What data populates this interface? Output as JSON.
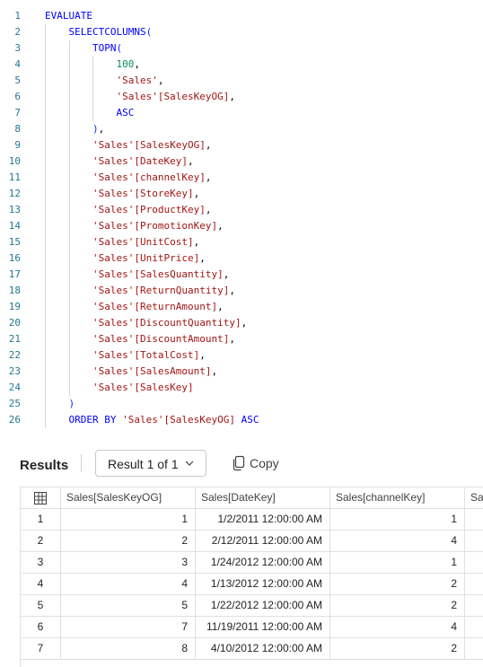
{
  "editor": {
    "lines": [
      {
        "n": "1",
        "indent": 0,
        "tokens": [
          {
            "t": "EVALUATE",
            "c": "keyword"
          }
        ]
      },
      {
        "n": "2",
        "indent": 1,
        "tokens": [
          {
            "t": "SELECTCOLUMNS",
            "c": "func"
          },
          {
            "t": "(",
            "c": "punct"
          }
        ]
      },
      {
        "n": "3",
        "indent": 2,
        "tokens": [
          {
            "t": "TOPN",
            "c": "func"
          },
          {
            "t": "(",
            "c": "punct"
          }
        ]
      },
      {
        "n": "4",
        "indent": 3,
        "tokens": [
          {
            "t": "100",
            "c": "number"
          },
          {
            "t": ",",
            "c": "plain"
          }
        ]
      },
      {
        "n": "5",
        "indent": 3,
        "tokens": [
          {
            "t": "'Sales'",
            "c": "string"
          },
          {
            "t": ",",
            "c": "plain"
          }
        ]
      },
      {
        "n": "6",
        "indent": 3,
        "tokens": [
          {
            "t": "'Sales'[SalesKeyOG]",
            "c": "column"
          },
          {
            "t": ",",
            "c": "plain"
          }
        ]
      },
      {
        "n": "7",
        "indent": 3,
        "tokens": [
          {
            "t": "ASC",
            "c": "keyword"
          }
        ]
      },
      {
        "n": "8",
        "indent": 2,
        "tokens": [
          {
            "t": ")",
            "c": "punct"
          },
          {
            "t": ",",
            "c": "plain"
          }
        ]
      },
      {
        "n": "9",
        "indent": 2,
        "tokens": [
          {
            "t": "'Sales'[SalesKeyOG]",
            "c": "column"
          },
          {
            "t": ",",
            "c": "plain"
          }
        ]
      },
      {
        "n": "10",
        "indent": 2,
        "tokens": [
          {
            "t": "'Sales'[DateKey]",
            "c": "column"
          },
          {
            "t": ",",
            "c": "plain"
          }
        ]
      },
      {
        "n": "11",
        "indent": 2,
        "tokens": [
          {
            "t": "'Sales'[channelKey]",
            "c": "column"
          },
          {
            "t": ",",
            "c": "plain"
          }
        ]
      },
      {
        "n": "12",
        "indent": 2,
        "tokens": [
          {
            "t": "'Sales'[StoreKey]",
            "c": "column"
          },
          {
            "t": ",",
            "c": "plain"
          }
        ]
      },
      {
        "n": "13",
        "indent": 2,
        "tokens": [
          {
            "t": "'Sales'[ProductKey]",
            "c": "column"
          },
          {
            "t": ",",
            "c": "plain"
          }
        ]
      },
      {
        "n": "14",
        "indent": 2,
        "tokens": [
          {
            "t": "'Sales'[PromotionKey]",
            "c": "column"
          },
          {
            "t": ",",
            "c": "plain"
          }
        ]
      },
      {
        "n": "15",
        "indent": 2,
        "tokens": [
          {
            "t": "'Sales'[UnitCost]",
            "c": "column"
          },
          {
            "t": ",",
            "c": "plain"
          }
        ]
      },
      {
        "n": "16",
        "indent": 2,
        "tokens": [
          {
            "t": "'Sales'[UnitPrice]",
            "c": "column"
          },
          {
            "t": ",",
            "c": "plain"
          }
        ]
      },
      {
        "n": "17",
        "indent": 2,
        "tokens": [
          {
            "t": "'Sales'[SalesQuantity]",
            "c": "column"
          },
          {
            "t": ",",
            "c": "plain"
          }
        ]
      },
      {
        "n": "18",
        "indent": 2,
        "tokens": [
          {
            "t": "'Sales'[ReturnQuantity]",
            "c": "column"
          },
          {
            "t": ",",
            "c": "plain"
          }
        ]
      },
      {
        "n": "19",
        "indent": 2,
        "tokens": [
          {
            "t": "'Sales'[ReturnAmount]",
            "c": "column"
          },
          {
            "t": ",",
            "c": "plain"
          }
        ]
      },
      {
        "n": "20",
        "indent": 2,
        "tokens": [
          {
            "t": "'Sales'[DiscountQuantity]",
            "c": "column"
          },
          {
            "t": ",",
            "c": "plain"
          }
        ]
      },
      {
        "n": "21",
        "indent": 2,
        "tokens": [
          {
            "t": "'Sales'[DiscountAmount]",
            "c": "column"
          },
          {
            "t": ",",
            "c": "plain"
          }
        ]
      },
      {
        "n": "22",
        "indent": 2,
        "tokens": [
          {
            "t": "'Sales'[TotalCost]",
            "c": "column"
          },
          {
            "t": ",",
            "c": "plain"
          }
        ]
      },
      {
        "n": "23",
        "indent": 2,
        "tokens": [
          {
            "t": "'Sales'[SalesAmount]",
            "c": "column"
          },
          {
            "t": ",",
            "c": "plain"
          }
        ]
      },
      {
        "n": "24",
        "indent": 2,
        "tokens": [
          {
            "t": "'Sales'[SalesKey]",
            "c": "column"
          }
        ]
      },
      {
        "n": "25",
        "indent": 1,
        "tokens": [
          {
            "t": ")",
            "c": "punct"
          }
        ]
      },
      {
        "n": "26",
        "indent": 1,
        "tokens": [
          {
            "t": "ORDER BY ",
            "c": "keyword"
          },
          {
            "t": "'Sales'[SalesKeyOG]",
            "c": "column"
          },
          {
            "t": " ASC",
            "c": "keyword"
          }
        ]
      }
    ]
  },
  "results": {
    "title": "Results",
    "selector_label": "Result 1 of 1",
    "copy_label": "Copy"
  },
  "grid": {
    "columns": [
      "Sales[SalesKeyOG]",
      "Sales[DateKey]",
      "Sales[channelKey]",
      "Sal"
    ],
    "rows": [
      [
        "1",
        "1",
        "1/2/2011 12:00:00 AM",
        "1"
      ],
      [
        "2",
        "2",
        "2/12/2011 12:00:00 AM",
        "4"
      ],
      [
        "3",
        "3",
        "1/24/2012 12:00:00 AM",
        "1"
      ],
      [
        "4",
        "4",
        "1/13/2012 12:00:00 AM",
        "2"
      ],
      [
        "5",
        "5",
        "1/22/2012 12:00:00 AM",
        "2"
      ],
      [
        "6",
        "7",
        "11/19/2011 12:00:00 AM",
        "4"
      ],
      [
        "7",
        "8",
        "4/10/2012 12:00:00 AM",
        "2"
      ]
    ]
  },
  "colors": {
    "keyword": "#0000ff",
    "string": "#a31515",
    "number": "#098658",
    "line_number": "#237893"
  }
}
